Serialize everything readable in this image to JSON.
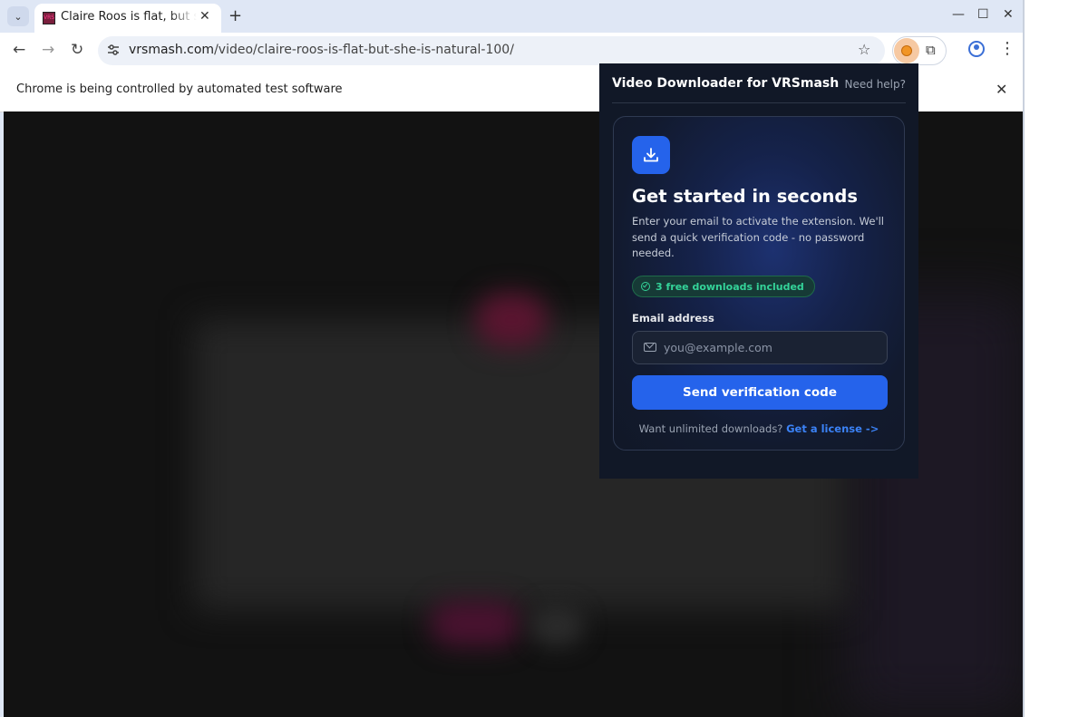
{
  "browser": {
    "tab": {
      "title": "Claire Roos is flat, but she is natural",
      "favicon_label": "VRS",
      "close_symbol": "✕"
    },
    "new_tab_symbol": "+",
    "tab_search_symbol": "⌄",
    "window_controls": {
      "minimize": "—",
      "maximize": "☐",
      "close": "✕"
    },
    "nav": {
      "back": "←",
      "forward": "→",
      "reload": "↻"
    },
    "address": {
      "site_info_icon": "tune-icon",
      "host": "vrsmash.com",
      "path": "/video/claire-roos-is-flat-but-she-is-natural-100/"
    },
    "bookmark_symbol": "☆",
    "extensions_symbol": "⧉",
    "menu_symbol": "⋮",
    "infobar": {
      "text": "Chrome is being controlled by automated test software",
      "close_symbol": "✕"
    }
  },
  "extension_popup": {
    "title": "Video Downloader for VRSmash",
    "help_link": "Need help?",
    "card": {
      "icon": "download-icon",
      "heading": "Get started in seconds",
      "description": "Enter your email to activate the extension. We'll send a quick verification code - no password needed.",
      "badge": "3 free downloads included",
      "email_label": "Email address",
      "email_placeholder": "you@example.com",
      "email_value": "",
      "send_button": "Send verification code",
      "footer_text": "Want unlimited downloads?",
      "footer_link": "Get a license ->"
    }
  },
  "colors": {
    "accent": "#2563eb",
    "popup_bg": "#111827",
    "badge_green": "#34d399",
    "link_blue": "#3b82f6",
    "page_bg": "#121212"
  }
}
